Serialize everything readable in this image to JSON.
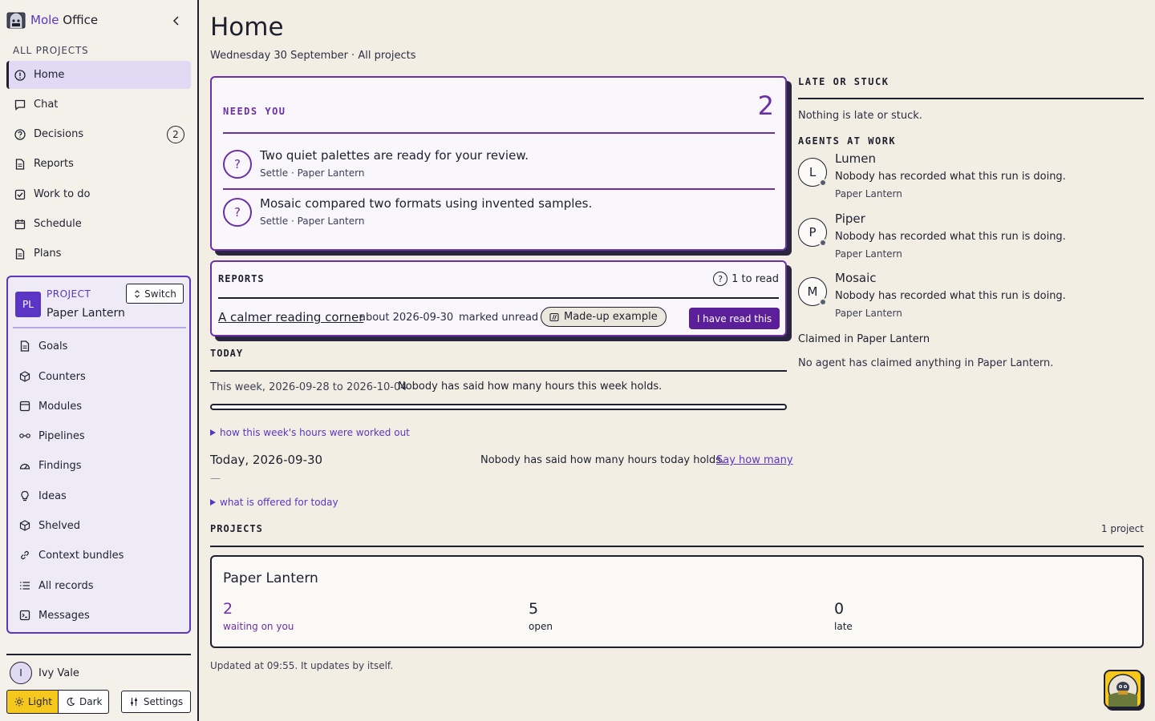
{
  "app": {
    "name_part1": "Mole",
    "name_part2": "Office"
  },
  "sidebar": {
    "section_label": "ALL PROJECTS",
    "items": [
      {
        "label": "Home",
        "icon": "alert-circle-icon"
      },
      {
        "label": "Chat",
        "icon": "chat-icon"
      },
      {
        "label": "Decisions",
        "icon": "question-circle-icon",
        "badge": "2"
      },
      {
        "label": "Reports",
        "icon": "document-icon"
      },
      {
        "label": "Work to do",
        "icon": "checkbox-icon"
      },
      {
        "label": "Schedule",
        "icon": "calendar-icon"
      },
      {
        "label": "Plans",
        "icon": "document-icon"
      }
    ],
    "project": {
      "kicker": "PROJECT",
      "avatar": "PL",
      "name": "Paper Lantern",
      "switch_label": "Switch",
      "items": [
        {
          "label": "Goals",
          "icon": "document-icon"
        },
        {
          "label": "Counters",
          "icon": "cube-icon"
        },
        {
          "label": "Modules",
          "icon": "window-icon"
        },
        {
          "label": "Pipelines",
          "icon": "link-glasses-icon"
        },
        {
          "label": "Findings",
          "icon": "gauge-icon"
        },
        {
          "label": "Ideas",
          "icon": "lightbulb-icon"
        },
        {
          "label": "Shelved",
          "icon": "cube-icon"
        },
        {
          "label": "Context bundles",
          "icon": "link-icon"
        },
        {
          "label": "All records",
          "icon": "list-icon"
        },
        {
          "label": "Messages",
          "icon": "terminal-icon"
        }
      ]
    },
    "user": {
      "initial": "I",
      "name": "Ivy Vale"
    },
    "theme": {
      "light": "Light",
      "dark": "Dark",
      "selected": "Light"
    },
    "settings_label": "Settings"
  },
  "main": {
    "title": "Home",
    "subtitle": "Wednesday 30 September · All projects",
    "needs_you": {
      "title": "NEEDS YOU",
      "count": "2",
      "items": [
        {
          "text": "Two quiet palettes are ready for your review.",
          "meta": "Settle · Paper Lantern"
        },
        {
          "text": "Mosaic compared two formats using invented samples.",
          "meta": "Settle · Paper Lantern"
        }
      ]
    },
    "reports": {
      "title": "REPORTS",
      "to_read": "1 to read",
      "item": {
        "title": "A calmer reading corner",
        "about": "about 2026-09-30",
        "status": "marked unread",
        "chip": "Made-up example",
        "action": "I have read this"
      }
    },
    "today": {
      "title": "TODAY",
      "week_label": "This week, 2026-09-28 to 2026-10-04",
      "week_note": "Nobody has said how many hours this week holds.",
      "week_progress": 0,
      "week_disclosure": "how this week's hours were worked out",
      "day_label": "Today, 2026-09-30",
      "day_note": "Nobody has said how many hours today holds.",
      "day_action": "Say how many",
      "day_dash": "—",
      "day_disclosure": "what is offered for today"
    },
    "projects": {
      "title": "PROJECTS",
      "count": "1 project",
      "cards": [
        {
          "name": "Paper Lantern",
          "stats": [
            {
              "value": "2",
              "label": "waiting on you"
            },
            {
              "value": "5",
              "label": "open"
            },
            {
              "value": "0",
              "label": "late"
            }
          ]
        }
      ]
    },
    "updated": "Updated at 09:55. It updates by itself."
  },
  "right": {
    "late_title": "LATE OR STUCK",
    "late_text": "Nothing is late or stuck.",
    "agents_title": "AGENTS AT WORK",
    "agents": [
      {
        "initial": "L",
        "name": "Lumen",
        "doing": "Nobody has recorded what this run is doing.",
        "project": "Paper Lantern"
      },
      {
        "initial": "P",
        "name": "Piper",
        "doing": "Nobody has recorded what this run is doing.",
        "project": "Paper Lantern"
      },
      {
        "initial": "M",
        "name": "Mosaic",
        "doing": "Nobody has recorded what this run is doing.",
        "project": "Paper Lantern"
      }
    ],
    "claimed_title": "Claimed in Paper Lantern",
    "claimed_text": "No agent has claimed anything in Paper Lantern."
  },
  "colors": {
    "accent": "#5b35c4",
    "needs": "#6b2fa6",
    "theme_selected": "#f6c71d"
  }
}
